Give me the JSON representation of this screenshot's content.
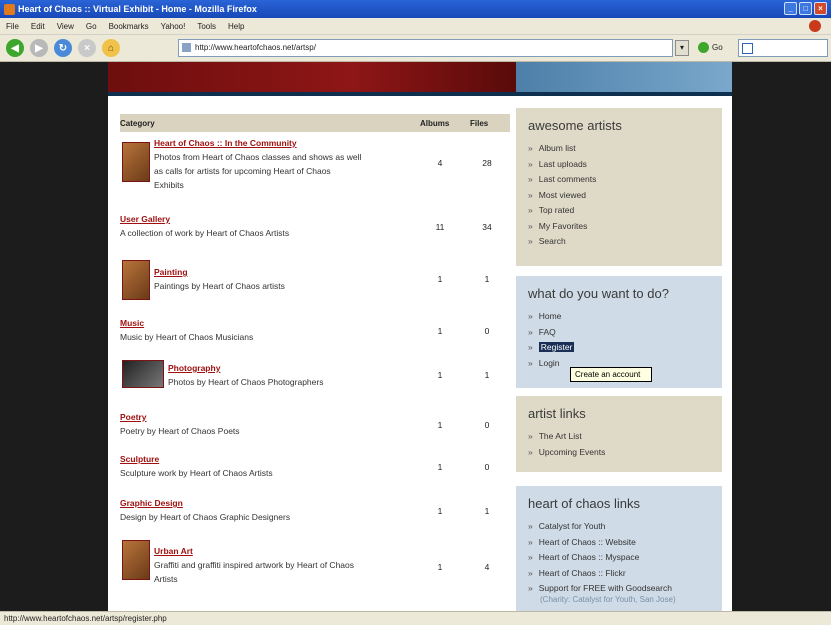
{
  "window": {
    "title": "Heart of Chaos :: Virtual Exhibit - Home - Mozilla Firefox"
  },
  "menu": [
    "File",
    "Edit",
    "View",
    "Go",
    "Bookmarks",
    "Yahoo!",
    "Tools",
    "Help"
  ],
  "navigation": {
    "url": "http://www.heartofchaos.net/artsp/",
    "go_label": "Go"
  },
  "colors": {
    "accent_red": "#a01010",
    "banner_red": "#8e1616",
    "banner_blue": "#5c8bb2"
  },
  "table": {
    "headers": {
      "category": "Category",
      "albums": "Albums",
      "files": "Files"
    },
    "rows": [
      {
        "title": "Heart of Chaos :: In the Community",
        "desc_lines": [
          "Photos from Heart of Chaos classes and shows as well",
          "as calls for artists for upcoming Heart of Chaos",
          "Exhibits"
        ],
        "albums": "4",
        "files": "28",
        "thumb": "community-thumbnail"
      },
      {
        "title": "User Gallery",
        "desc_lines": [
          "A collection of work by Heart of Chaos Artists"
        ],
        "albums": "11",
        "files": "34"
      },
      {
        "title": "Painting",
        "desc_lines": [
          "Paintings by Heart of Chaos artists"
        ],
        "albums": "1",
        "files": "1",
        "thumb": "painting-thumbnail"
      },
      {
        "title": "Music",
        "desc_lines": [
          "Music by Heart of Chaos Musicians"
        ],
        "albums": "1",
        "files": "0"
      },
      {
        "title": "Photography",
        "desc_lines": [
          "Photos by Heart of Chaos Photographers"
        ],
        "albums": "1",
        "files": "1",
        "thumb": "photography-thumbnail"
      },
      {
        "title": "Poetry",
        "desc_lines": [
          "Poetry by Heart of Chaos Poets"
        ],
        "albums": "1",
        "files": "0"
      },
      {
        "title": "Sculpture",
        "desc_lines": [
          "Sculpture work by Heart of Chaos Artists"
        ],
        "albums": "1",
        "files": "0"
      },
      {
        "title": "Graphic Design",
        "desc_lines": [
          "Design by Heart of Chaos Graphic Designers"
        ],
        "albums": "1",
        "files": "1"
      },
      {
        "title": "Urban Art",
        "desc_lines": [
          "Graffiti and graffiti inspired artwork by Heart of Chaos",
          "Artists"
        ],
        "albums": "1",
        "files": "4",
        "thumb": "urban-art-thumbnail"
      }
    ]
  },
  "sidebar": {
    "awesome": {
      "title": "awesome artists",
      "items": [
        "Album list",
        "Last uploads",
        "Last comments",
        "Most viewed",
        "Top rated",
        "My Favorites",
        "Search"
      ]
    },
    "todo": {
      "title": "what do you want to do?",
      "items": [
        "Home",
        "FAQ",
        "Register",
        "Login"
      ],
      "selected": "Register"
    },
    "tooltip": "Create an account",
    "artist_links": {
      "title": "artist links",
      "items": [
        "The Art List",
        "Upcoming Events"
      ]
    },
    "hoc_links": {
      "title": "heart of chaos links",
      "items": [
        "Catalyst for Youth",
        "Heart of Chaos :: Website",
        "Heart of Chaos :: Myspace",
        "Heart of Chaos :: Flickr",
        "Support for FREE with Goodsearch"
      ],
      "sub": "(Charity: Catalyst for Youth, San Jose)"
    }
  },
  "status": {
    "text": "http://www.heartofchaos.net/artsp/register.php"
  }
}
